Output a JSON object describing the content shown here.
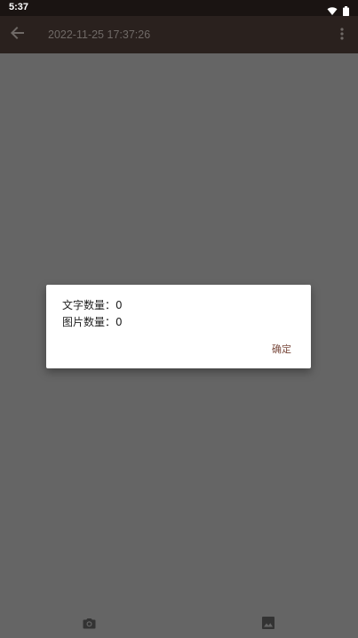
{
  "status_bar": {
    "time": "5:37",
    "icons": [
      "wifi-icon",
      "battery-icon"
    ]
  },
  "app_bar": {
    "title": "2022-11-25 17:37:26",
    "back_icon": "arrow-left-icon",
    "menu_icon": "more-vert-icon"
  },
  "dialog": {
    "text_count_label": "文字数量：",
    "text_count_value": "0",
    "image_count_label": "图片数量：",
    "image_count_value": "0",
    "ok_label": "确定"
  },
  "bottom_actions": {
    "camera_icon": "camera-icon",
    "gallery_icon": "image-icon"
  },
  "colors": {
    "status_bar_bg": "#1a1412",
    "app_bar_bg": "#2a211e",
    "scrim_bg": "#656565",
    "accent": "#7a4a3d"
  }
}
